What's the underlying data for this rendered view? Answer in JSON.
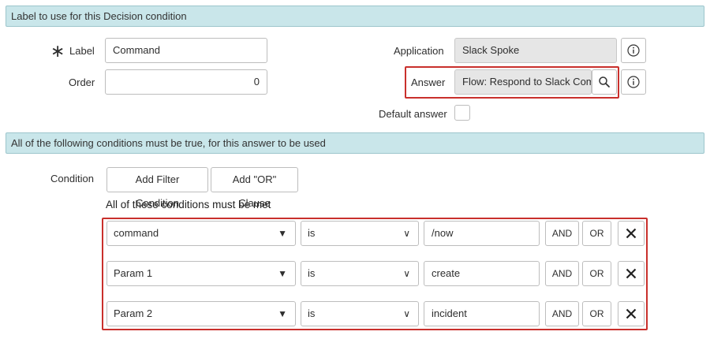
{
  "section1": {
    "title": "Label to use for this Decision condition"
  },
  "form": {
    "label_label": "Label",
    "label_value": "Command",
    "order_label": "Order",
    "order_value": "0",
    "application_label": "Application",
    "application_value": "Slack Spoke",
    "answer_label": "Answer",
    "answer_value": "Flow: Respond to Slack Com",
    "default_answer_label": "Default answer",
    "required_marker": "∗"
  },
  "section2": {
    "title": "All of the following conditions must be true, for this answer to be used"
  },
  "conditions": {
    "label": "Condition",
    "add_filter_label": "Add Filter Condition",
    "add_or_label": "Add \"OR\" Clause",
    "met_text": "All of these conditions must be met",
    "rows": [
      {
        "field": "command",
        "operator": "is",
        "value": "/now",
        "and": "AND",
        "or": "OR"
      },
      {
        "field": "Param 1",
        "operator": "is",
        "value": "create",
        "and": "AND",
        "or": "OR"
      },
      {
        "field": "Param 2",
        "operator": "is",
        "value": "incident",
        "and": "AND",
        "or": "OR"
      }
    ]
  },
  "icons": {
    "info": "info-icon",
    "search": "search-icon",
    "delete": "close-icon",
    "dropdown_field": "▼",
    "dropdown_operator": "∨"
  }
}
